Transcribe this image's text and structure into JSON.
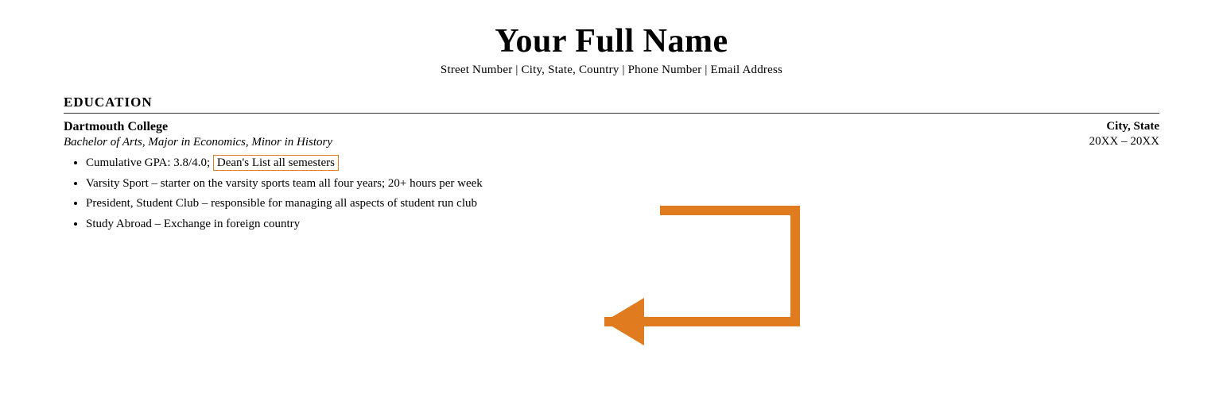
{
  "header": {
    "full_name": "Your Full Name",
    "contact_line": "Street Number | City, State, Country | Phone Number | Email Address"
  },
  "sections": {
    "education": {
      "title": "EDUCATION",
      "institution": "Dartmouth College",
      "location": "City, State",
      "degree": "Bachelor of Arts, Major in Economics, Minor in History",
      "dates": "20XX – 20XX",
      "bullets": [
        {
          "prefix": "Cumulative GPA: 3.8/4.0; ",
          "highlighted": "Dean's List all semesters",
          "suffix": ""
        },
        {
          "prefix": "Varsity Sport – starter on the varsity sports team all four years; 20+ hours per week",
          "highlighted": "",
          "suffix": ""
        },
        {
          "prefix": "President, Student Club – responsible for managing all aspects of student run club",
          "highlighted": "",
          "suffix": ""
        },
        {
          "prefix": "Study Abroad – Exchange in foreign country",
          "highlighted": "",
          "suffix": ""
        }
      ]
    }
  }
}
